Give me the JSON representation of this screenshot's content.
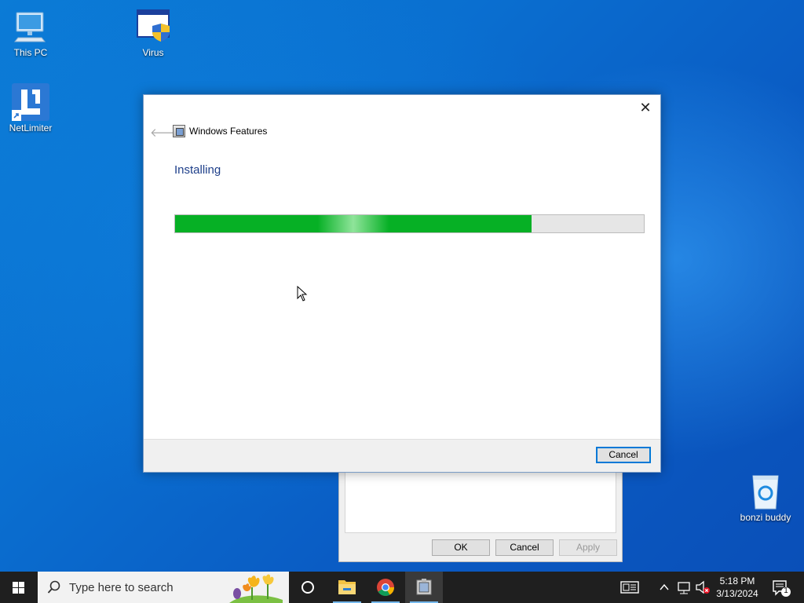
{
  "desktop": {
    "icons": [
      {
        "label": "This PC",
        "icon": "computer-icon"
      },
      {
        "label": "Virus",
        "icon": "shield-window-icon"
      },
      {
        "label": "NetLimiter",
        "icon": "netlimiter-icon"
      },
      {
        "label": "bonzi buddy",
        "icon": "recycle-bin-icon"
      }
    ]
  },
  "dialog": {
    "title": "Windows Features",
    "heading": "Installing",
    "progress": 0.76,
    "cancel_label": "Cancel",
    "close_glyph": "✕",
    "back_glyph": "🡐"
  },
  "back_dialog": {
    "ok_label": "OK",
    "cancel_label": "Cancel",
    "apply_label": "Apply"
  },
  "taskbar": {
    "search_placeholder": "Type here to search",
    "apps": [
      "cortana-icon",
      "file-explorer-icon",
      "chrome-icon",
      "windows-features-icon"
    ],
    "time": "5:18 PM",
    "date": "3/13/2024",
    "notification_count": "1"
  },
  "colors": {
    "progress_fill": "#06b025",
    "accent": "#0078d7",
    "heading": "#1e3f8a"
  }
}
